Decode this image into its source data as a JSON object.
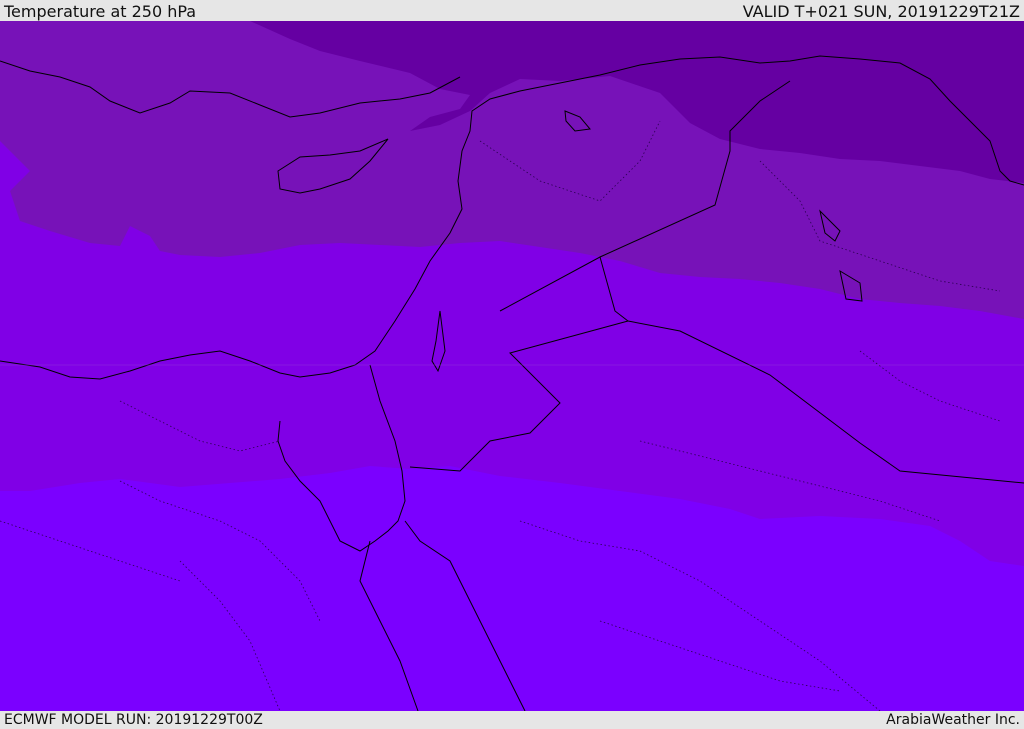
{
  "header": {
    "title": "Temperature at 250 hPa",
    "valid": "VALID T+021 SUN, 20191229T21Z"
  },
  "footer": {
    "model_run": "ECMWF MODEL RUN: 20191229T00Z",
    "credit": "ArabiaWeather Inc."
  },
  "colors": {
    "band_coldest": "#6500a2",
    "band_cold": "#7712b8",
    "band_mid": "#8000e6",
    "band_warm": "#7b00ff",
    "coastline": "#000000",
    "bar_background": "#e6e6e6"
  }
}
